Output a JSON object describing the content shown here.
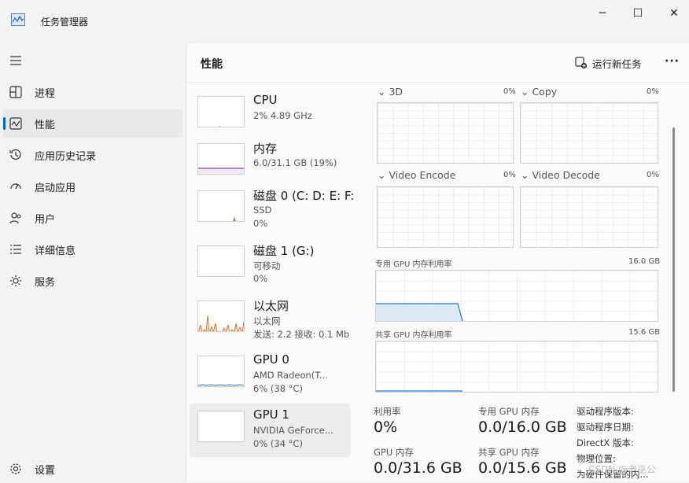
{
  "app": {
    "title": "任务管理器"
  },
  "window_controls": {
    "minimize": "─",
    "maximize": "☐",
    "close": "✕"
  },
  "nav": {
    "items": [
      {
        "label": "进程",
        "icon": "processes-icon"
      },
      {
        "label": "性能",
        "icon": "performance-icon",
        "active": true
      },
      {
        "label": "应用历史记录",
        "icon": "history-icon"
      },
      {
        "label": "启动应用",
        "icon": "startup-icon"
      },
      {
        "label": "用户",
        "icon": "users-icon"
      },
      {
        "label": "详细信息",
        "icon": "details-icon"
      },
      {
        "label": "服务",
        "icon": "services-icon"
      }
    ],
    "settings": "设置"
  },
  "header": {
    "title": "性能",
    "run_task": "运行新任务",
    "more": "···"
  },
  "devices": [
    {
      "name": "CPU",
      "sub1": "2% 4.89 GHz",
      "sub2": ""
    },
    {
      "name": "内存",
      "sub1": "6.0/31.1 GB (19%)",
      "sub2": ""
    },
    {
      "name": "磁盘 0 (C: D: E: F:",
      "sub1": "SSD",
      "sub2": "0%"
    },
    {
      "name": "磁盘 1 (G:)",
      "sub1": "可移动",
      "sub2": "0%"
    },
    {
      "name": "以太网",
      "sub1": "以太网",
      "sub2": "发送: 2.2 接收: 0.1 Mb"
    },
    {
      "name": "GPU 0",
      "sub1": "AMD Radeon(T...",
      "sub2": "6% (38 °C)"
    },
    {
      "name": "GPU 1",
      "sub1": "NVIDIA GeForce...",
      "sub2": "0% (34 °C)",
      "selected": true
    }
  ],
  "graphs": {
    "g3d": {
      "label": "3D",
      "pct": "0%"
    },
    "copy": {
      "label": "Copy",
      "pct": "0%"
    },
    "encode": {
      "label": "Video Encode",
      "pct": "0%"
    },
    "decode": {
      "label": "Video Decode",
      "pct": "0%"
    },
    "dedicated": {
      "label": "专用 GPU 内存利用率",
      "max": "16.0 GB",
      "usage_fraction": 0.0
    },
    "shared": {
      "label": "共享 GPU 内存利用率",
      "max": "15.6 GB",
      "usage_fraction": 0.0
    }
  },
  "stats": {
    "utilization": {
      "label": "利用率",
      "value": "0%"
    },
    "dedicated_mem": {
      "label": "专用 GPU 内存",
      "value": "0.0/16.0 GB"
    },
    "gpu_mem": {
      "label": "GPU 内存",
      "value": "0.0/31.6 GB"
    },
    "shared_mem": {
      "label": "共享 GPU 内存",
      "value": "0.0/15.6 GB"
    }
  },
  "info": {
    "driver_version": "驱动程序版本:",
    "driver_date": "驱动程序日期:",
    "directx": "DirectX 版本:",
    "location": "物理位置:",
    "reserved": "为硬件保留的内..."
  },
  "watermark": "CSDN @老巫公",
  "colors": {
    "accent": "#0067c0",
    "memory": "#8e3fa0",
    "disk": "#4caf50",
    "ethernet": "#d2691e",
    "gpu": "#2a74c8"
  }
}
